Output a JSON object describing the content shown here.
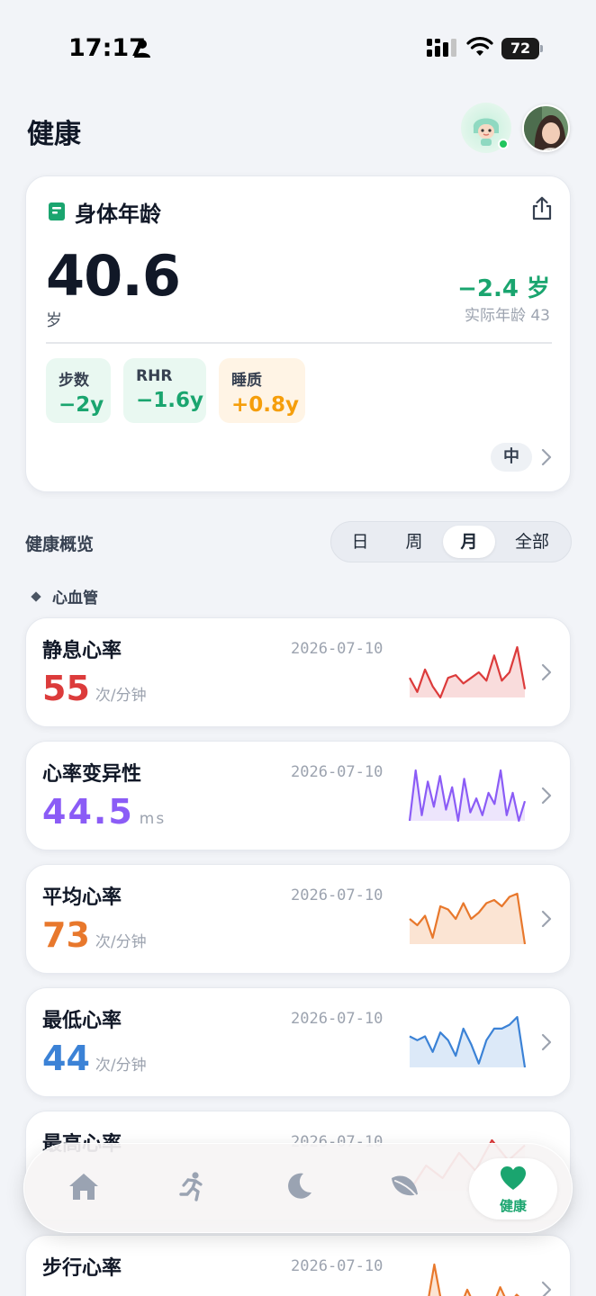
{
  "status_bar": {
    "time": "17:17",
    "battery": "72"
  },
  "header": {
    "title": "健康"
  },
  "body_age": {
    "title": "身体年龄",
    "value": "40.6",
    "unit": "岁",
    "difference": "−2.4 岁",
    "actual_age": "实际年龄  43",
    "factors": [
      {
        "label": "步数",
        "value": "−2y",
        "tone": "green"
      },
      {
        "label": "RHR",
        "value": "−1.6y",
        "tone": "green"
      },
      {
        "label": "睡质",
        "value": "+0.8y",
        "tone": "orange"
      }
    ],
    "level": "中"
  },
  "overview": {
    "title": "健康概览",
    "ranges": [
      "日",
      "周",
      "月",
      "全部"
    ],
    "selected_range": "月"
  },
  "section": {
    "label": "心血管"
  },
  "metrics": [
    {
      "name": "静息心率",
      "date": "2026-07-10",
      "value": "55",
      "unit": "次/分钟",
      "color": "#dc3b3b",
      "fill": "#f9dcdc",
      "trend": [
        52,
        47,
        55,
        49,
        45,
        52,
        53,
        50,
        52,
        54,
        51,
        60,
        51,
        54,
        63,
        48
      ]
    },
    {
      "name": "心率变异性",
      "date": "2026-07-10",
      "value": "44.5",
      "unit": "ms",
      "color": "#8b5cf6",
      "fill": "#ede5fc",
      "trend": [
        40,
        58,
        42,
        54,
        45,
        56,
        44,
        52,
        40,
        55,
        43,
        48,
        42,
        50,
        46,
        58,
        42,
        50,
        40,
        47
      ]
    },
    {
      "name": "平均心率",
      "date": "2026-07-10",
      "value": "73",
      "unit": "次/分钟",
      "color": "#e8782c",
      "fill": "#fbe4d3",
      "trend": [
        72,
        70,
        73,
        66,
        76,
        75,
        72,
        77,
        72,
        74,
        77,
        78,
        76,
        79,
        80,
        64
      ]
    },
    {
      "name": "最低心率",
      "date": "2026-07-10",
      "value": "44",
      "unit": "次/分钟",
      "color": "#3b82d6",
      "fill": "#dce9f8",
      "trend": [
        46,
        45,
        46,
        42,
        47,
        45,
        41,
        48,
        44,
        39,
        45,
        48,
        48,
        49,
        51,
        38
      ]
    },
    {
      "name": "最高心率",
      "date": "2026-07-10",
      "value": "",
      "unit": "",
      "color": "#dc3b3b",
      "fill": "#f9dcdc",
      "trend": [
        100,
        110,
        105,
        115,
        108,
        120,
        112,
        118
      ]
    },
    {
      "name": "步行心率",
      "date": "2026-07-10",
      "value": "",
      "unit": "",
      "color": "#e8782c",
      "fill": "#fbe4d3",
      "trend": [
        90,
        100,
        92,
        130,
        95,
        98,
        94,
        110,
        96,
        100,
        95,
        112,
        98,
        106,
        100
      ]
    }
  ],
  "nav": {
    "items": [
      {
        "icon": "home-icon"
      },
      {
        "icon": "run-icon"
      },
      {
        "icon": "moon-icon"
      },
      {
        "icon": "leaf-icon"
      },
      {
        "icon": "heart-icon",
        "label": "健康"
      }
    ],
    "active_label": "健康"
  }
}
